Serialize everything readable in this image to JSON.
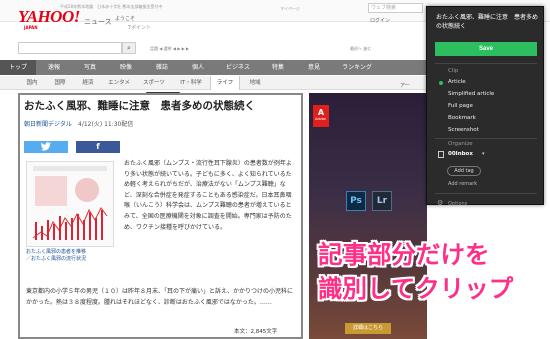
{
  "header": {
    "top_note": "平成28年熊本地震　日本赤十字社 熊本支部義援金受付中",
    "logo": "YAHOO!",
    "logo_sub": "JAPAN",
    "news_tag": "ニュース",
    "welcome": "ようこそ",
    "points": "Tポイント",
    "top_small": "マイページ",
    "search_top_placeholder": "ウェブ検索",
    "top_right": "ログイン"
  },
  "searchbar": {
    "placeholder": "",
    "search_icon": "search-icon",
    "row_small": "話題 ◀ 選挙 ◀ ▶ ▶ ▶",
    "row_right": "最初へ 進む"
  },
  "nav": {
    "tabs": [
      "トップ",
      "速報",
      "写真",
      "映像",
      "雑誌",
      "個人",
      "ビジネス",
      "特集",
      "意見",
      "ランキング"
    ],
    "active_index": 0,
    "subtabs": [
      "国内",
      "国際",
      "経済",
      "エンタメ",
      "スポーツ",
      "IT・科学",
      "ライフ",
      "地域"
    ],
    "active_subtab": 6,
    "far_label": "アー"
  },
  "article": {
    "title": "おたふく風邪、難睡に注意　患者多めの状態続く",
    "source": "朝日新聞デジタル",
    "date": "4/12(火) 11:30配信",
    "twitter_icon": "twitter-icon",
    "facebook_icon": "facebook-icon",
    "figure_caption": "おたふく風邪の患者を推移\n／おたふく風邪の流行状況",
    "body": "おたふく風邪（ムンプス・流行性耳下腺炎）の患者数が例年より多い状態が続いている。子どもに多く、よく知られているため軽く考えられがちだが、治療法がない「ムンプス難聴」など、深刻な合併症を発症することもある感染症だ。日本耳鼻咽喉（いんこう）科学会は、ムンプス難聴の患者が増えているとみて、全国の医療機関を対象に調査を開始。専門家は予防のため、ワクチン接種を呼びかけている。",
    "body2": "東京都内の小学５年の男児（１０）は昨年８月末、「耳の下が痛い」と訴え、かかりつけの小児科にかかった。熱は３８度程度。腫れはそれほどなく、診断はおたふく風邪ではなかった。……",
    "char_count": "本文：2,845文字"
  },
  "ad": {
    "adobe_logo": "A",
    "adobe_word": "Adobe",
    "ps": "Ps",
    "lr": "Lr",
    "button": "詳細はこちら"
  },
  "overlay": {
    "line1": "記事部分だけを",
    "line2": "識別してクリップ"
  },
  "clipper": {
    "title": "おたふく風邪、難睡に注意　患者多めの状態続く",
    "save": "Save",
    "clip_label": "Clip",
    "options": [
      "Article",
      "Simplified article",
      "Full page",
      "Bookmark",
      "Screenshot"
    ],
    "selected": 0,
    "organize_label": "Organize",
    "notebook": "00Inbox",
    "add_tag": "Add tag",
    "add_remark": "Add remark",
    "options_label": "Options"
  },
  "colors": {
    "accent_green": "#2dbe60",
    "overlay_pink": "#ff2e86",
    "yahoo_red": "#e60012"
  }
}
